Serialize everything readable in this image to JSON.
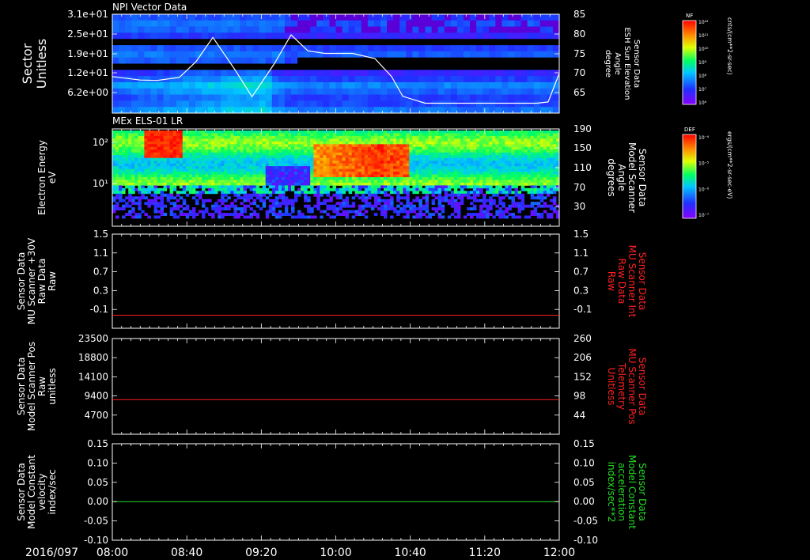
{
  "panels": [
    {
      "id": "npi",
      "title": "NPI Vector Data",
      "left_label": [
        "Sector",
        "Unitless"
      ],
      "right_label": [
        "Sensor Data",
        "ESH Sun Elevation",
        "Angle",
        "degree"
      ],
      "right_label_color": "#ffffff",
      "left_ticks": [
        "3.1e+01",
        "2.5e+01",
        "1.9e+01",
        "1.2e+01",
        "6.2e+00"
      ],
      "right_ticks": [
        "85",
        "80",
        "75",
        "70",
        "65"
      ]
    },
    {
      "id": "els",
      "title": "MEx ELS-01 LR",
      "left_label": [
        "Electron Energy",
        "eV"
      ],
      "right_label": [
        "Sensor Data",
        "Model Scanner",
        "Angle",
        "degrees"
      ],
      "right_label_color": "#ffffff",
      "left_ticks": [
        "10²",
        "10¹"
      ],
      "right_ticks": [
        "190",
        "150",
        "110",
        "70",
        "30"
      ]
    },
    {
      "id": "mu-raw",
      "title": "",
      "left_label": [
        "Sensor Data",
        "MU Scanner +30V",
        "Raw Data",
        "Raw"
      ],
      "right_label": [
        "Sensor Data",
        "MU Scanner Int",
        "Raw Data",
        "Raw"
      ],
      "right_label_color": "#ff2020",
      "left_ticks": [
        "1.5",
        "1.1",
        "0.7",
        "0.3",
        "-0.1"
      ],
      "right_ticks": [
        "1.5",
        "1.1",
        "0.7",
        "0.3",
        "-0.1"
      ]
    },
    {
      "id": "scanner-pos",
      "title": "",
      "left_label": [
        "Sensor Data",
        "Model Scanner Pos",
        "Raw",
        "unitless"
      ],
      "right_label": [
        "Sensor Data",
        "MU Scanner Pos",
        "Telemetry",
        "Unitless"
      ],
      "right_label_color": "#ff2020",
      "left_ticks": [
        "23500",
        "18800",
        "14100",
        "9400",
        "4700"
      ],
      "right_ticks": [
        "260",
        "206",
        "152",
        "98",
        "44"
      ]
    },
    {
      "id": "model-const",
      "title": "",
      "left_label": [
        "Sensor Data",
        "Model Constant",
        "velocity",
        "index/sec"
      ],
      "right_label": [
        "Sensor Data",
        "Model Constant",
        "acceleration",
        "index/sec**2"
      ],
      "right_label_color": "#22dd22",
      "left_ticks": [
        "0.15",
        "0.10",
        "0.05",
        "0.00",
        "-0.05",
        "-0.10"
      ],
      "right_ticks": [
        "0.15",
        "0.10",
        "0.05",
        "0.00",
        "-0.05",
        "-0.10"
      ]
    }
  ],
  "x_axis": {
    "date": "2016/097",
    "ticks": [
      "08:00",
      "08:40",
      "09:20",
      "10:00",
      "10:40",
      "11:20",
      "12:00"
    ]
  },
  "colorbars": [
    {
      "name": "NF",
      "unit": "cnts/(cm**2-sr-sec)",
      "tick_labels": [
        "10¹²",
        "10¹¹",
        "10¹⁰",
        "10⁹",
        "10⁸",
        "10⁷",
        "10⁶"
      ]
    },
    {
      "name": "DEF",
      "unit": "ergs/(cm**2-sr-sec-eV)",
      "tick_labels": [
        "10⁻⁴",
        "10⁻⁵",
        "10⁻⁶",
        "10⁻⁷"
      ]
    }
  ],
  "chart_data": [
    {
      "type": "heatmap",
      "title": "NPI Vector Data",
      "ylabel": "Sector Unitless",
      "overlay_line": {
        "name": "ESH Sun Elevation Angle",
        "x_hours": [
          8.0,
          8.25,
          8.4,
          8.6,
          8.75,
          8.9,
          9.1,
          9.25,
          9.45,
          9.6,
          9.75,
          9.9,
          10.15,
          10.35,
          10.5,
          10.6,
          10.8,
          11.0,
          11.2,
          11.5,
          11.8,
          11.9,
          12.0
        ],
        "y_deg": [
          70.5,
          69.7,
          69.6,
          70.3,
          74,
          79.6,
          72,
          65.8,
          73.5,
          80.2,
          76.5,
          75.9,
          75.9,
          74.7,
          70.5,
          65.9,
          64.3,
          64.3,
          64.3,
          64.3,
          64.3,
          64.6,
          71.2
        ],
        "ylim": [
          62,
          85
        ]
      }
    },
    {
      "type": "heatmap",
      "title": "MEx ELS-01 LR",
      "ylabel": "Electron Energy eV"
    },
    {
      "type": "line",
      "series": [
        {
          "name": "MU Scanner +30V Raw",
          "x_hours": [
            8.0,
            12.0
          ],
          "values": [
            -0.05,
            -0.05
          ],
          "color": "#ff2020"
        }
      ],
      "ylim": [
        -0.3,
        1.5
      ]
    },
    {
      "type": "line",
      "series": [
        {
          "name": "Model Scanner Pos Raw",
          "x_hours": [
            8.0,
            12.0
          ],
          "values": [
            8500,
            8500
          ],
          "color": "#ff2020"
        }
      ],
      "ylim": [
        0,
        23500
      ]
    },
    {
      "type": "line",
      "series": [
        {
          "name": "Model Constant velocity",
          "x_hours": [
            8.0,
            12.0
          ],
          "values": [
            0.0,
            0.0
          ],
          "color": "#22dd22"
        }
      ],
      "ylim": [
        -0.1,
        0.15
      ]
    }
  ]
}
